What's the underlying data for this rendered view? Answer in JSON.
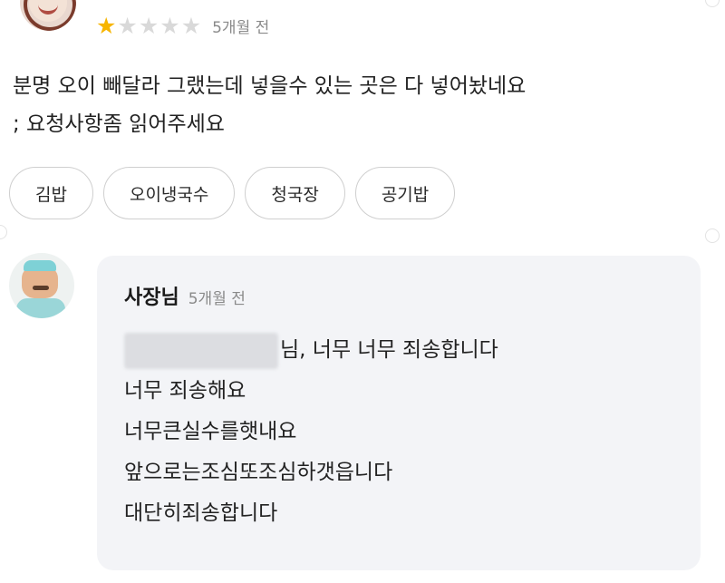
{
  "review": {
    "rating": 1,
    "rating_max": 5,
    "time_ago": "5개월 전",
    "lines": [
      "분명 오이 빼달라 그랬는데 넣을수 있는 곳은 다 넣어놨네요",
      "; 요청사항좀 읽어주세요"
    ],
    "menu_tags": [
      "김밥",
      "오이냉국수",
      "청국장",
      "공기밥"
    ]
  },
  "reply": {
    "author": "사장님",
    "time_ago": "5개월 전",
    "first_line_suffix": "님, 너무 너무 죄송합니다",
    "lines": [
      "너무 죄송해요",
      "너무큰실수를햇내요",
      "앞으로는조심또조심하갯읍니다",
      "대단히죄송합니다"
    ]
  },
  "colors": {
    "star_on": "#f7b500",
    "star_off": "#d9d9d9",
    "bubble_bg": "#f3f4f7",
    "chip_border": "#cfcfcf",
    "muted_text": "#8a8a8a"
  }
}
